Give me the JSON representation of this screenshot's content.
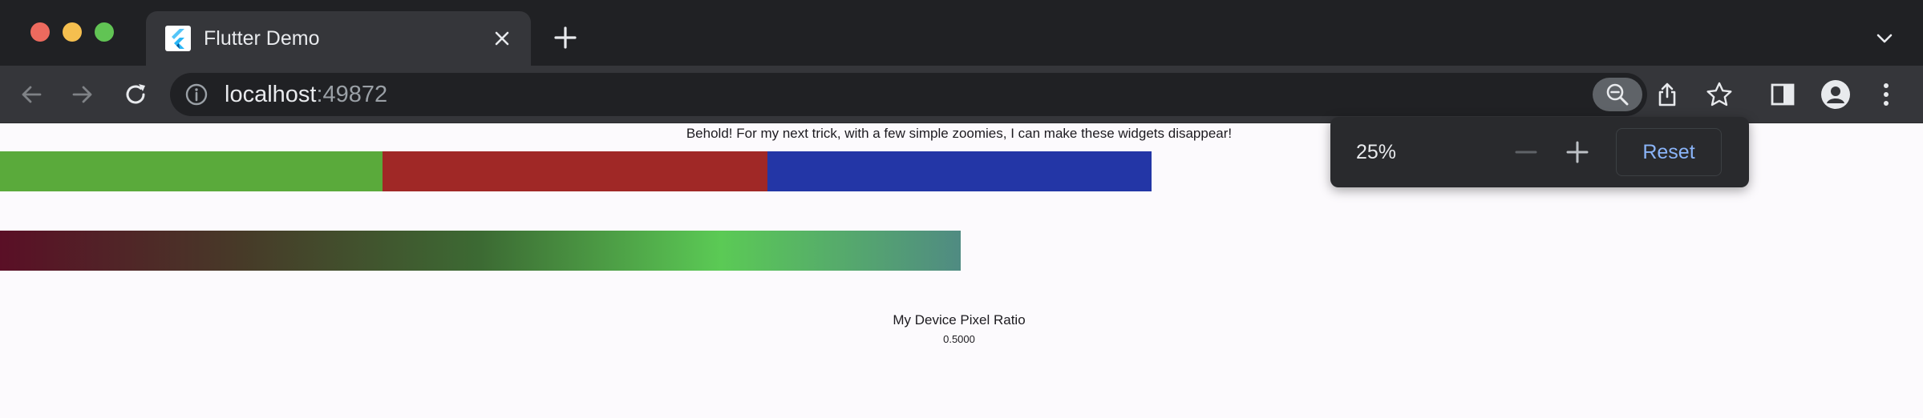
{
  "browser": {
    "tab": {
      "title": "Flutter Demo"
    },
    "omnibox": {
      "host": "localhost",
      "port": ":49872"
    },
    "icons": {
      "favicon": "flutter-logo-icon",
      "tab_close": "close-icon",
      "new_tab": "plus-icon",
      "tab_menu": "chevron-down-icon",
      "back": "arrow-left-icon",
      "forward": "arrow-right-icon",
      "reload": "reload-icon",
      "site_info": "info-icon",
      "zoom": "zoom-out-icon",
      "share": "share-icon",
      "bookmark": "star-icon",
      "side_panel": "side-panel-icon",
      "profile": "profile-icon",
      "menu": "kebab-menu-icon"
    }
  },
  "zoom_popup": {
    "level": "25%",
    "reset_label": "Reset"
  },
  "page": {
    "heading": "Behold! For my next trick, with a few simple zoomies, I can make these widgets disappear!",
    "color_bars": [
      {
        "color": "#5aaa3b"
      },
      {
        "color": "#a02826"
      },
      {
        "color": "#2336a6"
      }
    ],
    "gradient_stops": [
      "#5a0f26",
      "#473a28",
      "#3c6a33",
      "#5bca55",
      "#508b82"
    ],
    "dpr_label": "My Device Pixel Ratio",
    "dpr_value": "0.5000"
  },
  "colors": {
    "chrome_tabstrip": "#202124",
    "chrome_toolbar": "#35363a",
    "accent_link": "#8ab4f8",
    "page_bg": "#fcfafd"
  }
}
